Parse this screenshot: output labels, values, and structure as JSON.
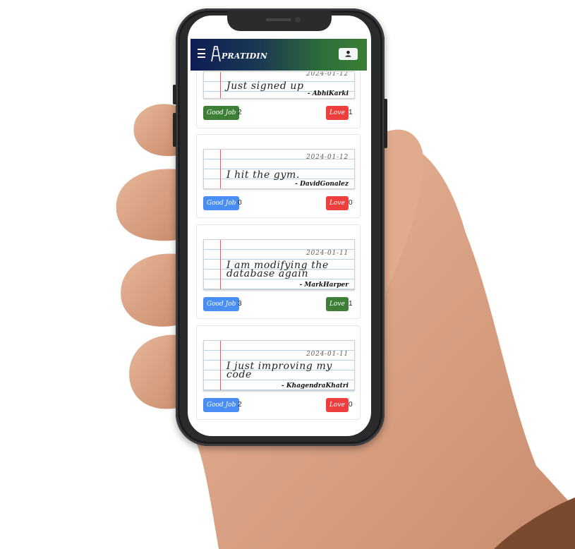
{
  "app": {
    "brand": "PRATIDIN",
    "menu_icon": "hamburger-menu-icon",
    "user_icon": "user-icon",
    "colors": {
      "nav_start": "#0e1d56",
      "nav_end": "#3b7e35",
      "good_active": "#3d7f36",
      "good": "#4a8df3",
      "love": "#ee3e3e",
      "love_active": "#3d7f36"
    }
  },
  "posts": [
    {
      "date": "2024-01-12",
      "text": "Just signed up",
      "author": "- AbhiKarki",
      "good_label": "Good Job",
      "good_count": "2",
      "love_label": "Love",
      "love_count": "1"
    },
    {
      "date": "2024-01-12",
      "text": "I hit the gym.",
      "author": "- DavidGonalez",
      "good_label": "Good Job",
      "good_count": "0",
      "love_label": "Love",
      "love_count": "0"
    },
    {
      "date": "2024-01-11",
      "text": "I am modifying the database again",
      "author": "- MarkHarper",
      "good_label": "Good Job",
      "good_count": "3",
      "love_label": "Love",
      "love_count": "1"
    },
    {
      "date": "2024-01-11",
      "text": "I just improving my code",
      "author": "- KhagendraKhatri",
      "good_label": "Good Job",
      "good_count": "2",
      "love_label": "Love",
      "love_count": "0"
    }
  ]
}
